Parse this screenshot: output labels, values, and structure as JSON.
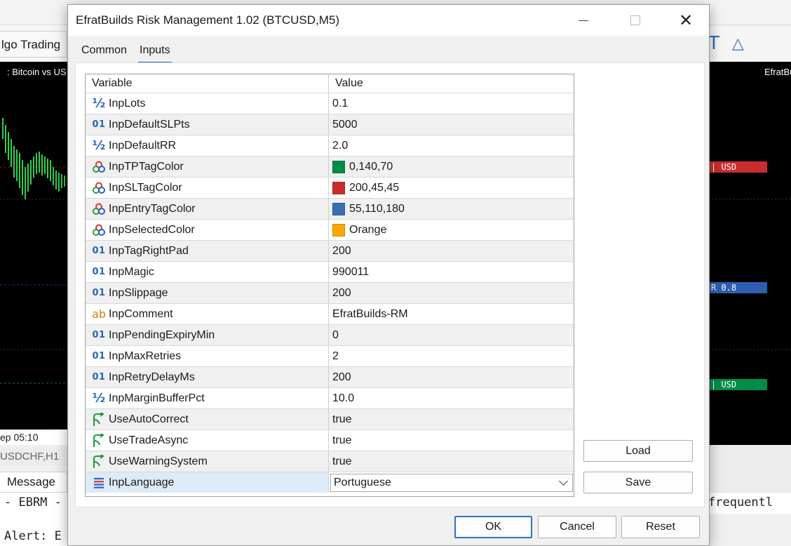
{
  "background": {
    "algo_label": "lgo Trading",
    "chart_title_left": ": Bitcoin vs US",
    "chart_title_right": "EfratBu",
    "date_label": "ep 05:10",
    "tab_symbol": "USDCHF,H1",
    "message_header": "Message",
    "log_line_1": "- EBRM -",
    "log_line_2": "Alert: E",
    "log_right": " frequentl",
    "price_tag_1": "| USD",
    "price_tag_2": "R  0.8",
    "price_tag_3": "| USD"
  },
  "dialog": {
    "title": "EfratBuilds Risk Management 1.02 (BTCUSD,M5)",
    "tabs": [
      {
        "label": "Common"
      },
      {
        "label": "Inputs",
        "active": true
      }
    ],
    "grid": {
      "col_variable": "Variable",
      "col_value": "Value",
      "rows": [
        {
          "type": "double",
          "icon": "½",
          "name": "InpLots",
          "value": "0.1"
        },
        {
          "type": "int",
          "icon": "01",
          "name": "InpDefaultSLPts",
          "value": "5000"
        },
        {
          "type": "double",
          "icon": "½",
          "name": "InpDefaultRR",
          "value": "2.0"
        },
        {
          "type": "color",
          "name": "InpTPTagColor",
          "value": "0,140,70",
          "swatch": "#008c46"
        },
        {
          "type": "color",
          "name": "InpSLTagColor",
          "value": "200,45,45",
          "swatch": "#c82d2d"
        },
        {
          "type": "color",
          "name": "InpEntryTagColor",
          "value": "55,110,180",
          "swatch": "#376eb4"
        },
        {
          "type": "color",
          "name": "InpSelectedColor",
          "value": "Orange",
          "swatch": "#ffa500"
        },
        {
          "type": "int",
          "icon": "01",
          "name": "InpTagRightPad",
          "value": "200"
        },
        {
          "type": "int",
          "icon": "01",
          "name": "InpMagic",
          "value": "990011"
        },
        {
          "type": "int",
          "icon": "01",
          "name": "InpSlippage",
          "value": "200"
        },
        {
          "type": "string",
          "icon": "ab",
          "name": "InpComment",
          "value": "EfratBuilds-RM"
        },
        {
          "type": "int",
          "icon": "01",
          "name": "InpPendingExpiryMin",
          "value": "0"
        },
        {
          "type": "int",
          "icon": "01",
          "name": "InpMaxRetries",
          "value": "2"
        },
        {
          "type": "int",
          "icon": "01",
          "name": "InpRetryDelayMs",
          "value": "200"
        },
        {
          "type": "double",
          "icon": "½",
          "name": "InpMarginBufferPct",
          "value": "10.0"
        },
        {
          "type": "bool",
          "name": "UseAutoCorrect",
          "value": "true"
        },
        {
          "type": "bool",
          "name": "UseTradeAsync",
          "value": "true"
        },
        {
          "type": "bool",
          "name": "UseWarningSystem",
          "value": "true"
        },
        {
          "type": "enum",
          "name": "InpLanguage",
          "value": "Portuguese",
          "selected": true
        }
      ]
    },
    "buttons": {
      "load": "Load",
      "save": "Save",
      "ok": "OK",
      "cancel": "Cancel",
      "reset": "Reset"
    }
  },
  "colors": {
    "accent": "#1e6fbf",
    "tag_red": "#c82d2d",
    "tag_blue": "#2d5fb0",
    "tag_green": "#008c46"
  }
}
